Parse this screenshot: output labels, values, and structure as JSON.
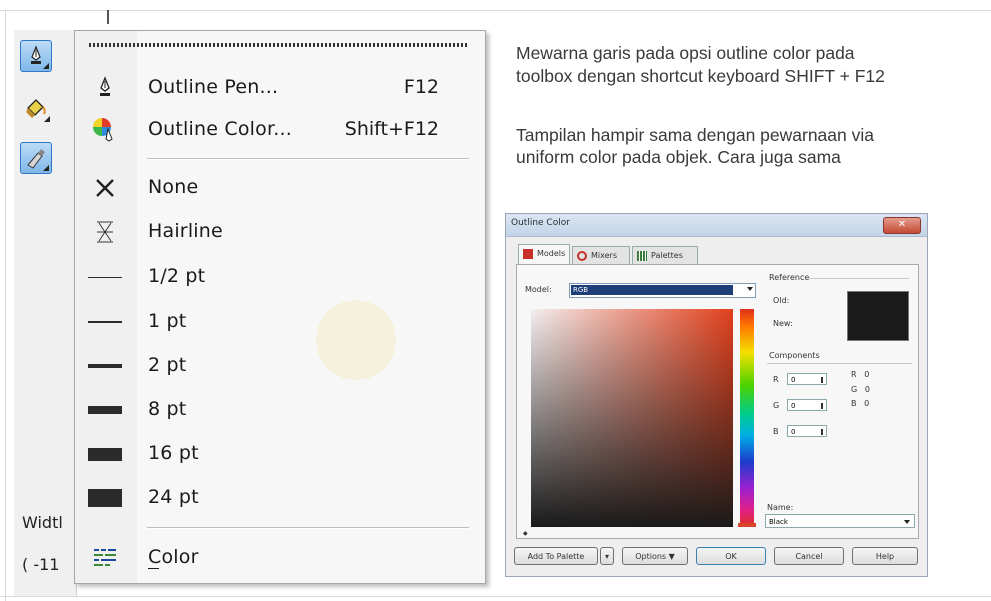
{
  "toolbox": {
    "width_label": "Widtl",
    "coord_label": "( -11"
  },
  "menu": {
    "items": [
      {
        "label": "Outline Pen...",
        "shortcut": "F12",
        "icon": "outline-pen-icon"
      },
      {
        "label": "Outline Color...",
        "shortcut": "Shift+F12",
        "icon": "outline-color-icon"
      },
      {
        "label": "None",
        "icon": "none-x-icon"
      },
      {
        "label": "Hairline",
        "icon": "hairline-icon"
      },
      {
        "label": "1/2 pt",
        "icon": "line-half-pt-icon"
      },
      {
        "label": "1 pt",
        "icon": "line-1pt-icon"
      },
      {
        "label": "2 pt",
        "icon": "line-2pt-icon"
      },
      {
        "label": "8 pt",
        "icon": "line-8pt-icon"
      },
      {
        "label": "16 pt",
        "icon": "line-16pt-icon"
      },
      {
        "label": "24 pt",
        "icon": "line-24pt-icon"
      },
      {
        "label": "Color",
        "icon": "color-docker-icon"
      }
    ]
  },
  "description": {
    "line1": "Mewarna garis pada opsi outline color pada",
    "line2": "toolbox dengan shortcut  keyboard SHIFT + F12",
    "line3": "Tampilan hampir sama dengan pewarnaan via",
    "line4": "uniform color pada objek. Cara juga sama"
  },
  "dialog": {
    "title": "Outline Color",
    "tabs": [
      "Models",
      "Mixers",
      "Palettes"
    ],
    "model_label": "Model:",
    "model_value": "RGB",
    "reference_label": "Reference",
    "old_label": "Old:",
    "new_label": "New:",
    "components_label": "Components",
    "components": [
      {
        "label": "R",
        "value": "0",
        "readout": "R   0"
      },
      {
        "label": "G",
        "value": "0",
        "readout": "G   0"
      },
      {
        "label": "B",
        "value": "0",
        "readout": "B   0"
      }
    ],
    "name_label": "Name:",
    "name_value": "Black",
    "buttons": {
      "add_to_palette": "Add To Palette",
      "options": "Options ▼",
      "ok": "OK",
      "cancel": "Cancel",
      "help": "Help"
    },
    "new_color": "#1a1a1a"
  },
  "colors": {
    "toolbox_active": "#7fb7e8",
    "menu_bg": "#f7f7f7",
    "dialog_titlebar": "#c3d4e8"
  }
}
